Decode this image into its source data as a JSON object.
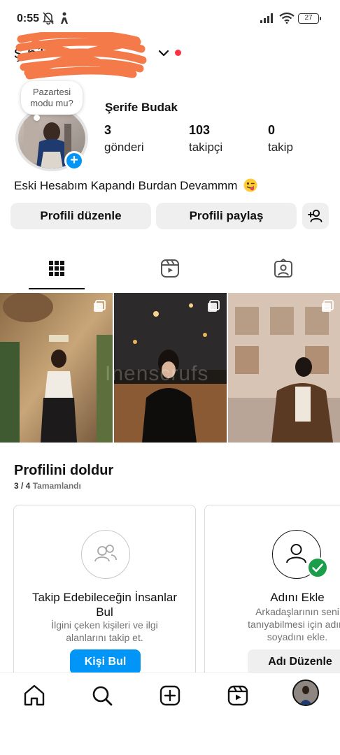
{
  "status_bar": {
    "time": "0:55",
    "battery": "27"
  },
  "header": {
    "username_visible": "ş        61"
  },
  "note": {
    "text_line1": "Pazartesi",
    "text_line2": "modu mu?"
  },
  "profile": {
    "full_name": "Şerife Budak",
    "stats": [
      {
        "value": "3",
        "label": "gönderi"
      },
      {
        "value": "103",
        "label": "takipçi"
      },
      {
        "value": "0",
        "label": "takip"
      }
    ],
    "bio": "Eski Hesabım Kapandı Burdan Devammm"
  },
  "actions": {
    "edit_profile": "Profili düzenle",
    "share_profile": "Profili paylaş"
  },
  "tabs": [
    {
      "icon": "grid-icon",
      "active": true
    },
    {
      "icon": "reels-icon",
      "active": false
    },
    {
      "icon": "tagged-icon",
      "active": false
    }
  ],
  "watermark": "Inenscrufs",
  "complete_profile": {
    "title": "Profilini doldur",
    "progress": "3 / 4",
    "progress_label": "Tamamlandı",
    "cards": [
      {
        "title_line1": "Takip Edebileceğin İnsanlar",
        "title_line2": "Bul",
        "desc_line1": "İlgini çeken kişileri ve ilgi",
        "desc_line2": "alanlarını takip et.",
        "button": "Kişi Bul",
        "completed": false
      },
      {
        "title_line1": "Adını Ekle",
        "desc_line1": "Arkadaşlarının seni",
        "desc_line2": "tanıyabilmesi için adını",
        "desc_line3": "soyadını ekle.",
        "button": "Adı Düzenle",
        "completed": true
      }
    ]
  },
  "bottom_nav": [
    "home-icon",
    "search-icon",
    "create-icon",
    "reels-icon",
    "profile-avatar"
  ],
  "colors": {
    "accent": "#0095f6",
    "notification_dot": "#ff3040",
    "success": "#1a9e4a",
    "button_bg": "#efefef",
    "scribble": "#f47a4a"
  }
}
